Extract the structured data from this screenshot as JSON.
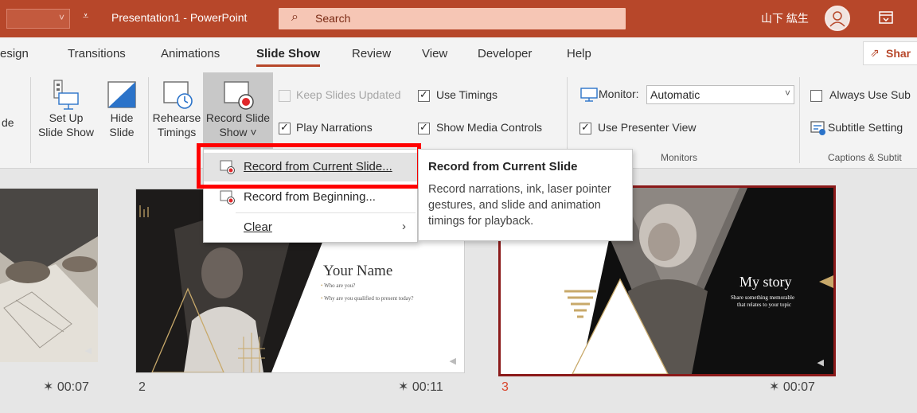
{
  "titlebar": {
    "doc_title": "Presentation1  -  PowerPoint",
    "search_placeholder": "Search",
    "user_name": "山下 紘生",
    "qat_customize_glyph": "⩡"
  },
  "tabs": [
    {
      "label": "esign"
    },
    {
      "label": "Transitions"
    },
    {
      "label": "Animations"
    },
    {
      "label": "Slide Show",
      "active": true
    },
    {
      "label": "Review"
    },
    {
      "label": "View"
    },
    {
      "label": "Developer"
    },
    {
      "label": "Help"
    }
  ],
  "share": {
    "label": "Shar"
  },
  "ribbon": {
    "clipped_label": "de",
    "setup_line1": "Set Up",
    "setup_line2": "Slide Show",
    "hide_line1": "Hide",
    "hide_line2": "Slide",
    "rehearse_line1": "Rehearse",
    "rehearse_line2": "Timings",
    "record_line1": "Record Slide",
    "record_line2": "Show ˅",
    "keep_updated": "Keep Slides Updated",
    "use_timings": "Use Timings",
    "play_narrations": "Play Narrations",
    "show_media_controls": "Show Media Controls",
    "monitor_label": "Monitor:",
    "monitor_value": "Automatic",
    "use_presenter_view": "Use Presenter View",
    "monitors_group": "Monitors",
    "always_use_subtitles": "Always Use Sub",
    "subtitle_settings": "Subtitle Setting",
    "captions_group": "Captions & Subtit"
  },
  "dropdown": {
    "items": [
      {
        "label": "Record from Current Slide..."
      },
      {
        "label": "Record from Beginning..."
      },
      {
        "label": "Clear",
        "submenu": true
      }
    ]
  },
  "tooltip": {
    "title": "Record from Current Slide",
    "body": "Record narrations, ink, laser pointer gestures, and slide and animation timings for playback."
  },
  "slides": [
    {
      "time": "00:07"
    },
    {
      "number": "2",
      "time": "00:11",
      "title": "Your Name",
      "bullet1": "Who are you?",
      "bullet2": "Why are you qualified to present today?"
    },
    {
      "number": "3",
      "time": "00:07",
      "title": "My story",
      "sub1": "Share something memorable",
      "sub2": "that relates to your topic"
    }
  ],
  "colors": {
    "accent": "#b7472a",
    "highlight": "#ff0000",
    "selected_slide_border": "#8b1a1a",
    "slide_number_selected": "#d9452b",
    "gold": "#c8a96a"
  }
}
